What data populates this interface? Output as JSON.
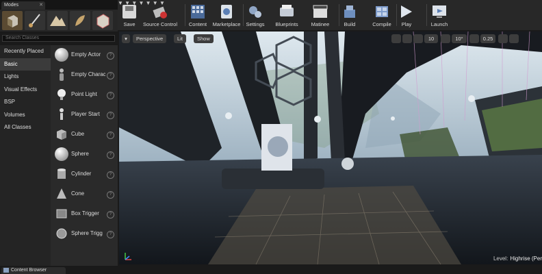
{
  "modes_panel": {
    "tab_title": "Modes",
    "search": {
      "placeholder": "Search Classes",
      "value": ""
    },
    "categories": [
      {
        "label": "Recently Placed"
      },
      {
        "label": "Basic"
      },
      {
        "label": "Lights"
      },
      {
        "label": "Visual Effects"
      },
      {
        "label": "BSP"
      },
      {
        "label": "Volumes"
      },
      {
        "label": "All Classes"
      }
    ],
    "selected_category": "Basic",
    "items": [
      {
        "label": "Empty Actor",
        "icon": "sphere-icon"
      },
      {
        "label": "Empty Charac",
        "icon": "character-icon"
      },
      {
        "label": "Point Light",
        "icon": "lightbulb-icon"
      },
      {
        "label": "Player Start",
        "icon": "player-start-icon"
      },
      {
        "label": "Cube",
        "icon": "cube-icon"
      },
      {
        "label": "Sphere",
        "icon": "sphere-icon"
      },
      {
        "label": "Cylinder",
        "icon": "cylinder-icon"
      },
      {
        "label": "Cone",
        "icon": "cone-icon"
      },
      {
        "label": "Box Trigger",
        "icon": "box-trigger-icon"
      },
      {
        "label": "Sphere Trigg",
        "icon": "sphere-trigger-icon"
      }
    ],
    "help_glyph": "?"
  },
  "toolbar": {
    "buttons": [
      {
        "label": "Save",
        "icon": "save-icon"
      },
      {
        "label": "Source Control",
        "icon": "source-control-icon"
      },
      {
        "label": "Content",
        "icon": "content-icon"
      },
      {
        "label": "Marketplace",
        "icon": "marketplace-icon"
      },
      {
        "label": "Settings",
        "icon": "settings-icon"
      },
      {
        "label": "Blueprints",
        "icon": "blueprints-icon"
      },
      {
        "label": "Matinee",
        "icon": "matinee-icon"
      },
      {
        "label": "Build",
        "icon": "build-icon"
      },
      {
        "label": "Compile",
        "icon": "compile-icon"
      },
      {
        "label": "Play",
        "icon": "play-icon"
      },
      {
        "label": "Launch",
        "icon": "launch-icon"
      }
    ]
  },
  "viewport": {
    "view_mode": "Perspective",
    "lighting": "Lit",
    "show": "Show",
    "grid_snap": "10",
    "rotation_snap": "10°",
    "scale_snap": "0.25",
    "level_label": "Level:",
    "level_name": "Highrise (Per"
  },
  "content_browser": {
    "tab_title": "Content Browser"
  },
  "colors": {
    "accent": "#e8a83a",
    "selected_mode": "#5a4a32"
  }
}
